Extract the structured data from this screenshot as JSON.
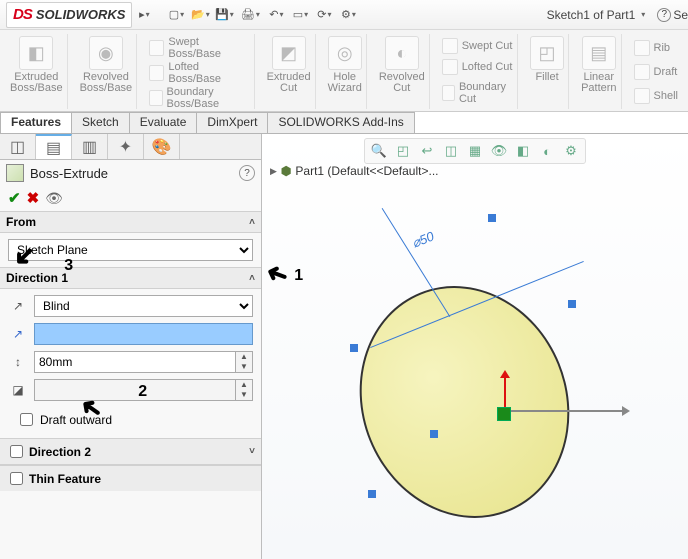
{
  "logo": {
    "ds": "DS",
    "name": "SOLIDWORKS"
  },
  "breadcrumb": "Sketch1 of Part1",
  "help_label": "Se",
  "ribbon": {
    "extruded_boss": "Extruded\nBoss/Base",
    "revolved_boss": "Revolved\nBoss/Base",
    "swept_boss": "Swept Boss/Base",
    "lofted_boss": "Lofted Boss/Base",
    "boundary_boss": "Boundary Boss/Base",
    "extruded_cut": "Extruded\nCut",
    "hole": "Hole\nWizard",
    "revolved_cut": "Revolved\nCut",
    "swept_cut": "Swept Cut",
    "lofted_cut": "Lofted Cut",
    "boundary_cut": "Boundary Cut",
    "fillet": "Fillet",
    "linear_pattern": "Linear\nPattern",
    "rib": "Rib",
    "draft": "Draft",
    "shell": "Shell"
  },
  "tabs": [
    "Features",
    "Sketch",
    "Evaluate",
    "DimXpert",
    "SOLIDWORKS Add-Ins"
  ],
  "active_tab": 0,
  "feature_panel": {
    "title": "Boss-Extrude",
    "from_label": "From",
    "from_value": "Sketch Plane",
    "dir1_label": "Direction 1",
    "dir1_end": "Blind",
    "depth_value": "80mm",
    "draft_outward": "Draft outward",
    "dir2_label": "Direction 2",
    "thin_label": "Thin Feature"
  },
  "tree_root": "Part1  (Default<<Default>...",
  "diameter_label": "⌀50",
  "annotations": {
    "a1": "1",
    "a2": "2",
    "a3": "3"
  }
}
